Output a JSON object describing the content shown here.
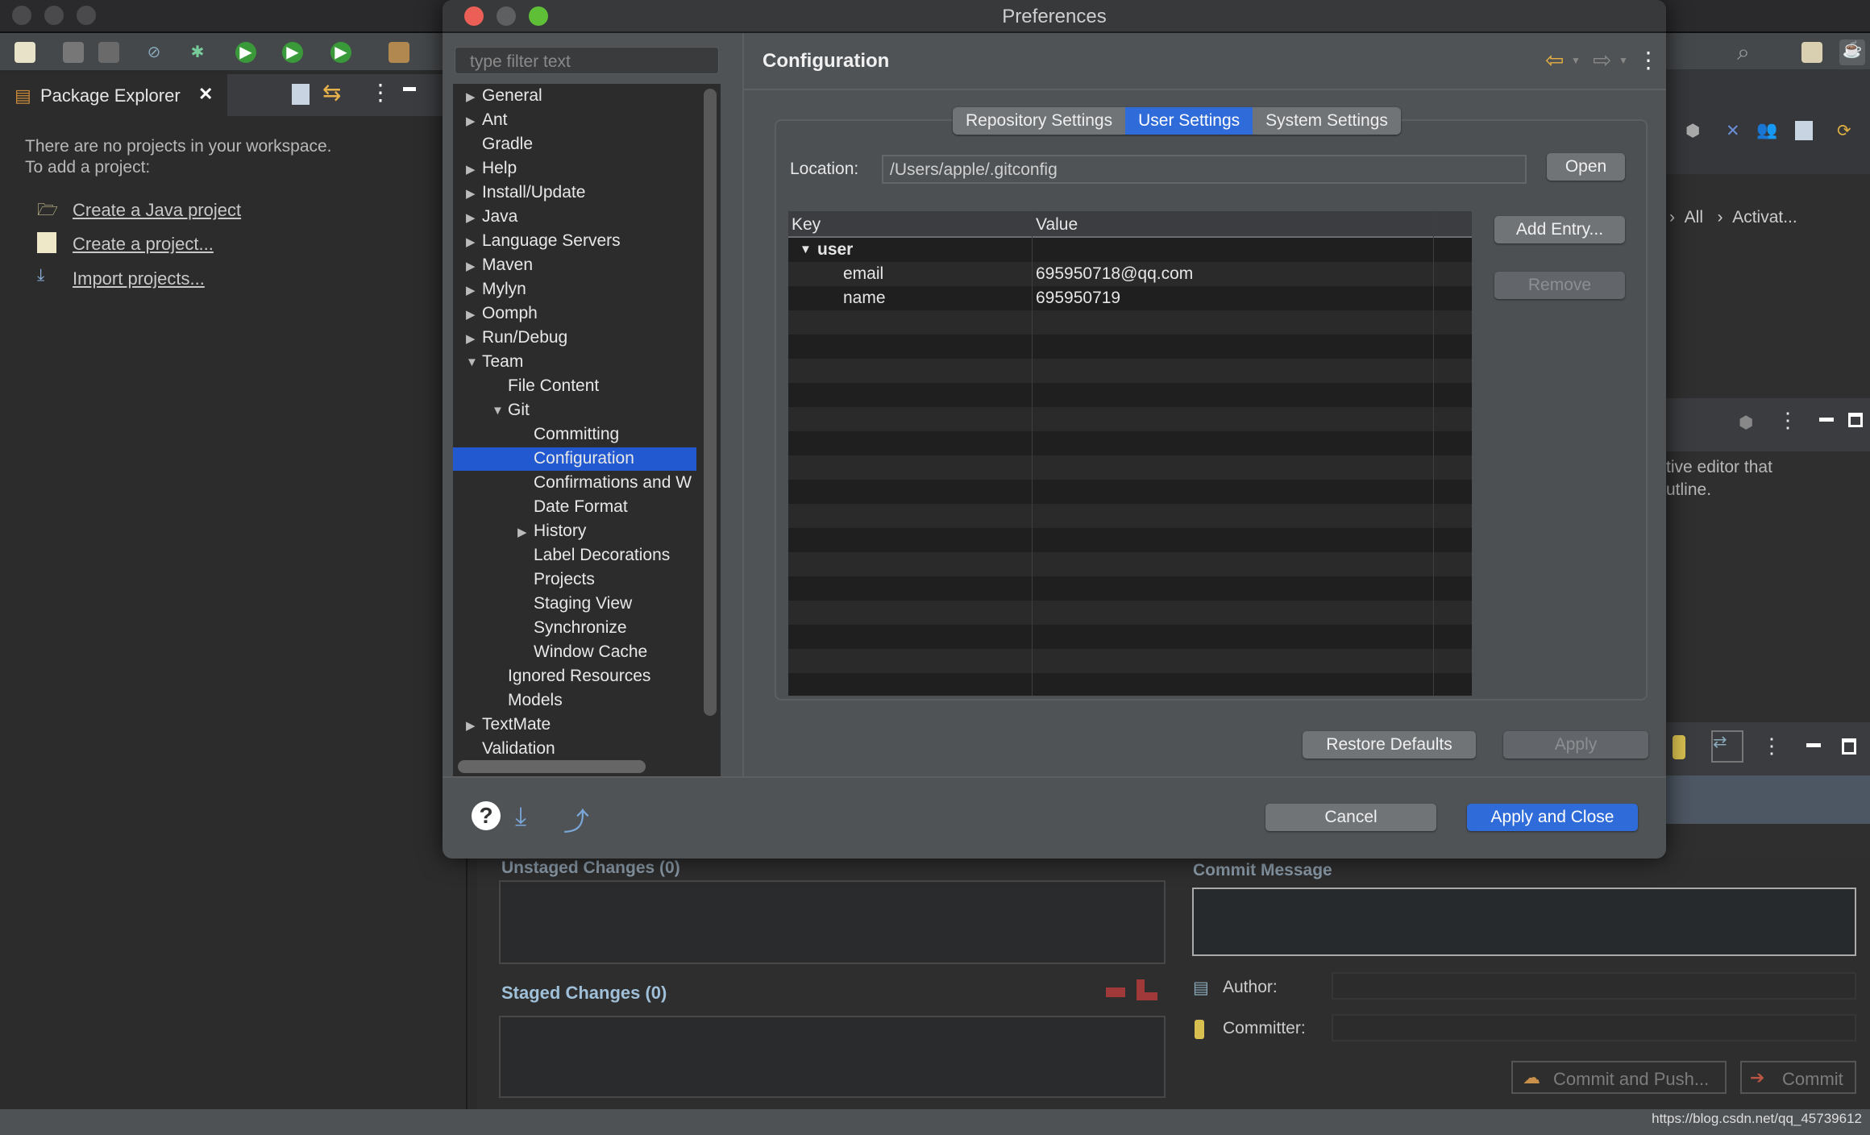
{
  "ide": {
    "package_explorer": {
      "tab_label": "Package Explorer",
      "empty_line1": "There are no projects in your workspace.",
      "empty_line2": "To add a project:",
      "links": [
        "Create a Java project",
        "Create a project...",
        "Import projects..."
      ]
    },
    "right": {
      "breadcrumb": [
        "All",
        "Activat..."
      ],
      "outline_text_1": "tive editor that",
      "outline_text_2": "utline."
    },
    "git_staging": {
      "unstaged_label": "Unstaged Changes (0)",
      "staged_label": "Staged Changes (0)",
      "commit_message_label": "Commit Message",
      "author_label": "Author:",
      "committer_label": "Committer:",
      "commit_and_push_label": "Commit and Push...",
      "commit_label": "Commit"
    },
    "watermark": "https://blog.csdn.net/qq_45739612"
  },
  "dialog": {
    "title": "Preferences",
    "filter_placeholder": "type filter text",
    "tree": [
      {
        "label": "General",
        "level": 0,
        "arrow": "right"
      },
      {
        "label": "Ant",
        "level": 0,
        "arrow": "right"
      },
      {
        "label": "Gradle",
        "level": 0,
        "arrow": ""
      },
      {
        "label": "Help",
        "level": 0,
        "arrow": "right"
      },
      {
        "label": "Install/Update",
        "level": 0,
        "arrow": "right"
      },
      {
        "label": "Java",
        "level": 0,
        "arrow": "right"
      },
      {
        "label": "Language Servers",
        "level": 0,
        "arrow": "right"
      },
      {
        "label": "Maven",
        "level": 0,
        "arrow": "right"
      },
      {
        "label": "Mylyn",
        "level": 0,
        "arrow": "right"
      },
      {
        "label": "Oomph",
        "level": 0,
        "arrow": "right"
      },
      {
        "label": "Run/Debug",
        "level": 0,
        "arrow": "right"
      },
      {
        "label": "Team",
        "level": 0,
        "arrow": "down"
      },
      {
        "label": "File Content",
        "level": 1,
        "arrow": ""
      },
      {
        "label": "Git",
        "level": 1,
        "arrow": "down"
      },
      {
        "label": "Committing",
        "level": 2,
        "arrow": ""
      },
      {
        "label": "Configuration",
        "level": 2,
        "arrow": "",
        "selected": true
      },
      {
        "label": "Confirmations and W",
        "level": 2,
        "arrow": ""
      },
      {
        "label": "Date Format",
        "level": 2,
        "arrow": ""
      },
      {
        "label": "History",
        "level": 2,
        "arrow": "right"
      },
      {
        "label": "Label Decorations",
        "level": 2,
        "arrow": ""
      },
      {
        "label": "Projects",
        "level": 2,
        "arrow": ""
      },
      {
        "label": "Staging View",
        "level": 2,
        "arrow": ""
      },
      {
        "label": "Synchronize",
        "level": 2,
        "arrow": ""
      },
      {
        "label": "Window Cache",
        "level": 2,
        "arrow": ""
      },
      {
        "label": "Ignored Resources",
        "level": 1,
        "arrow": ""
      },
      {
        "label": "Models",
        "level": 1,
        "arrow": ""
      },
      {
        "label": "TextMate",
        "level": 0,
        "arrow": "right"
      },
      {
        "label": "Validation",
        "level": 0,
        "arrow": ""
      }
    ],
    "page_title": "Configuration",
    "tabs": [
      {
        "label": "Repository Settings",
        "active": false
      },
      {
        "label": "User Settings",
        "active": true
      },
      {
        "label": "System Settings",
        "active": false
      }
    ],
    "location_label": "Location:",
    "location_value": "/Users/apple/.gitconfig",
    "open_label": "Open",
    "table": {
      "columns": [
        "Key",
        "Value"
      ],
      "rows": [
        {
          "key": "user",
          "value": "",
          "group": true
        },
        {
          "key": "email",
          "value": "695950718@qq.com"
        },
        {
          "key": "name",
          "value": "695950719"
        }
      ]
    },
    "add_entry_label": "Add Entry...",
    "remove_label": "Remove",
    "restore_defaults_label": "Restore Defaults",
    "apply_label": "Apply",
    "cancel_label": "Cancel",
    "apply_close_label": "Apply and Close",
    "accent_color": "#2f6bd9"
  }
}
